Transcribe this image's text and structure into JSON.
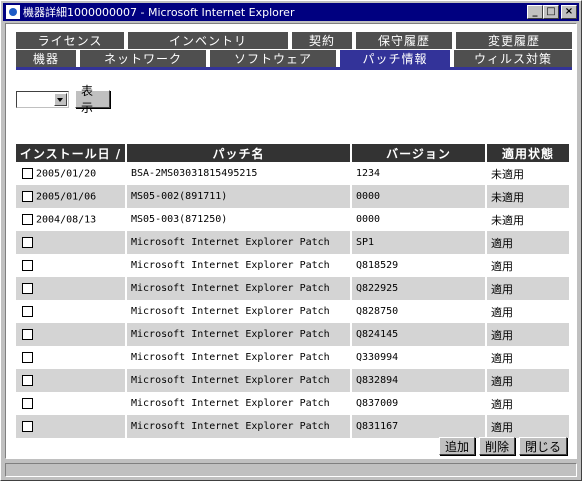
{
  "window": {
    "title": "機器詳細1000000007 - Microsoft Internet Explorer",
    "controls": [
      "_",
      "□",
      "×"
    ]
  },
  "tabs": {
    "row1": [
      {
        "label": "ライセンス"
      },
      {
        "label": "インベントリ"
      },
      {
        "label": "契約"
      },
      {
        "label": "保守履歴"
      },
      {
        "label": "変更履歴"
      }
    ],
    "row2": [
      {
        "label": "機器"
      },
      {
        "label": "ネットワーク"
      },
      {
        "label": "ソフトウェア"
      },
      {
        "label": "パッチ情報",
        "active": true
      },
      {
        "label": "ウィルス対策"
      }
    ]
  },
  "filter": {
    "select_value": "",
    "show_button": "表示"
  },
  "table": {
    "columns": [
      "インストール日 /",
      "パッチ名",
      "バージョン",
      "適用状態"
    ],
    "rows": [
      {
        "date": "2005/01/20",
        "name": "BSA-2MS03031815495215",
        "version": "1234",
        "status": "未適用"
      },
      {
        "date": "2005/01/06",
        "name": "MS05-002(891711)",
        "version": "0000",
        "status": "未適用"
      },
      {
        "date": "2004/08/13",
        "name": "MS05-003(871250)",
        "version": "0000",
        "status": "未適用"
      },
      {
        "date": "",
        "name": "Microsoft Internet Explorer Patch",
        "version": "SP1",
        "status": "適用"
      },
      {
        "date": "",
        "name": "Microsoft Internet Explorer Patch",
        "version": "Q818529",
        "status": "適用"
      },
      {
        "date": "",
        "name": "Microsoft Internet Explorer Patch",
        "version": "Q822925",
        "status": "適用"
      },
      {
        "date": "",
        "name": "Microsoft Internet Explorer Patch",
        "version": "Q828750",
        "status": "適用"
      },
      {
        "date": "",
        "name": "Microsoft Internet Explorer Patch",
        "version": "Q824145",
        "status": "適用"
      },
      {
        "date": "",
        "name": "Microsoft Internet Explorer Patch",
        "version": "Q330994",
        "status": "適用"
      },
      {
        "date": "",
        "name": "Microsoft Internet Explorer Patch",
        "version": "Q832894",
        "status": "適用"
      },
      {
        "date": "",
        "name": "Microsoft Internet Explorer Patch",
        "version": "Q837009",
        "status": "適用"
      },
      {
        "date": "",
        "name": "Microsoft Internet Explorer Patch",
        "version": "Q831167",
        "status": "適用"
      }
    ]
  },
  "actions": {
    "add": "追加",
    "delete": "削除",
    "close": "閉じる"
  },
  "colors": {
    "titlebar": "#000080",
    "active_tab": "#333399",
    "tab": "#4f4f4f",
    "header": "#333333",
    "row_alt": "#d4d4d4"
  }
}
